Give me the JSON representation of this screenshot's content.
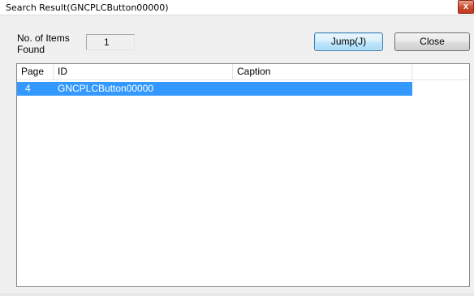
{
  "window": {
    "title": "Search Result(GNCPLCButton00000)",
    "close_glyph": "x"
  },
  "summary": {
    "found_label": "No. of Items\nFound",
    "found_label_line1": "No. of Items",
    "found_label_line2": "Found",
    "count": "1"
  },
  "buttons": {
    "jump_label": "Jump(J)",
    "close_label": "Close"
  },
  "list": {
    "columns": [
      "Page",
      "ID",
      "Caption",
      ""
    ],
    "rows": [
      {
        "page": "4",
        "id": "GNCPLCButton00000",
        "caption": "",
        "selected": true
      }
    ]
  },
  "colors": {
    "selection": "#3399ff",
    "dialog_bg": "#f0f0f0",
    "close_button": "#c74a2f"
  }
}
